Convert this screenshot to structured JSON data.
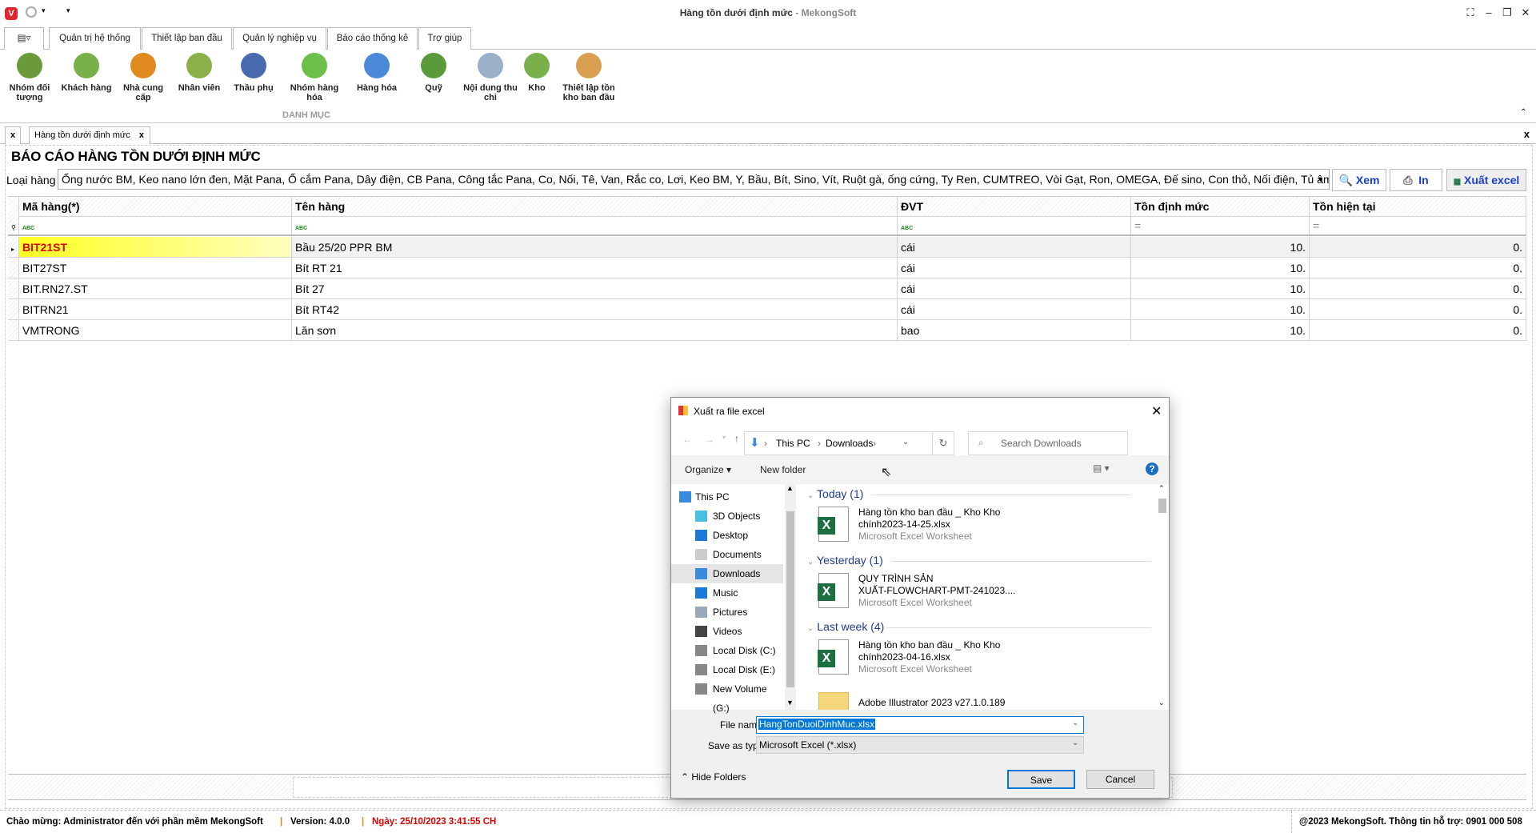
{
  "window": {
    "title": "Hàng tồn dưới định mức",
    "brand": " - MekongSoft",
    "logo": "V"
  },
  "menu_tabs": [
    "Quản trị hệ thống",
    "Thiết lập ban đầu",
    "Quản lý nghiệp vụ",
    "Báo cáo thống kê",
    "Trợ giúp"
  ],
  "ribbon": {
    "group": "DANH MỤC",
    "buttons": [
      {
        "label": "Nhóm đối tượng",
        "icon": "group-people-icon",
        "color": "#6a9a3a"
      },
      {
        "label": "Khách hàng",
        "icon": "customer-icon",
        "color": "#7ab04a"
      },
      {
        "label": "Nhà cung cấp",
        "icon": "supplier-icon",
        "color": "#e08a20"
      },
      {
        "label": "Nhân viên",
        "icon": "employee-icon",
        "color": "#8bb04a"
      },
      {
        "label": "Thầu phụ",
        "icon": "contractor-icon",
        "color": "#4a6ab0"
      },
      {
        "label": "Nhóm hàng hóa",
        "icon": "product-group-icon",
        "color": "#6cc04a"
      },
      {
        "label": "Hàng hóa",
        "icon": "star-icon",
        "color": "#4a8ad8"
      },
      {
        "label": "Quỹ",
        "icon": "money-icon",
        "color": "#5a9a3a"
      },
      {
        "label": "Nội dung thu chi",
        "icon": "document-add-icon",
        "color": "#9ab0c8"
      },
      {
        "label": "Kho",
        "icon": "warehouse-icon",
        "color": "#7ab04a"
      },
      {
        "label": "Thiết lập tồn kho ban đầu",
        "icon": "inventory-setup-icon",
        "color": "#d8a050"
      }
    ]
  },
  "doc_tab": {
    "label": "Hàng tồn dưới định mức",
    "close": "x"
  },
  "report": {
    "title": "BÁO CÁO HÀNG TỒN DƯỚI ĐỊNH MỨC",
    "filter_label": "Loại hàng",
    "filter_value": "Ống nước BM, Keo nano lớn đen, Mặt Pana, Ổ cắm Pana, Dây điện, CB Pana, Công tắc Pana, Co, Nối, Tê, Van, Rắc co, Lơi, Keo BM, Y, Bầu, Bít, Sino, Vít, Ruột gà, ống cứng, Ty Ren, CUMTREO, Vòi Gạt, Ron, OMEGA, Đế sino, Con thỏ, Nối điện, Tủ âm tườ...",
    "view_label": "Xem",
    "print_label": "In",
    "export_label": "Xuất excel"
  },
  "grid": {
    "columns": [
      "Mã hàng(*)",
      "Tên hàng",
      "ĐVT",
      "Tồn định mức",
      "Tồn hiện tại"
    ],
    "filter_ops": [
      "ABC",
      "ABC",
      "ABC",
      "=",
      "="
    ],
    "rows": [
      [
        "BIT21ST",
        "Bầu 25/20 PPR BM",
        "cái",
        "10.",
        "0."
      ],
      [
        "BIT27ST",
        "Bít RT 21",
        "cái",
        "10.",
        "0."
      ],
      [
        "BIT.RN27.ST",
        "Bít 27",
        "cái",
        "10.",
        "0."
      ],
      [
        "BITRN21",
        "Bít RT42",
        "cái",
        "10.",
        "0."
      ],
      [
        "VMTRONG",
        "Lăn sơn",
        "bao",
        "10.",
        "0."
      ]
    ]
  },
  "status": {
    "welcome": "Chào mừng: Administrator đến với phần mềm MekongSoft",
    "version": "Version: 4.0.0",
    "date": "Ngày: 25/10/2023 3:41:55 CH",
    "copyright": "@2023 MekongSoft. Thông tin hỗ trợ: 0901 000 508",
    "date_color": "#e00000"
  },
  "dialog": {
    "title": "Xuất ra file excel",
    "path": [
      "This PC",
      "Downloads"
    ],
    "search_placeholder": "Search Downloads",
    "organize": "Organize",
    "new_folder": "New folder",
    "nav": [
      "This PC",
      "3D Objects",
      "Desktop",
      "Documents",
      "Downloads",
      "Music",
      "Pictures",
      "Videos",
      "Local Disk (C:)",
      "Local Disk (E:)",
      "New Volume (G:)"
    ],
    "groups": [
      {
        "label": "Today (1)"
      },
      {
        "label": "Yesterday (1)"
      },
      {
        "label": "Last week (4)"
      }
    ],
    "files": [
      {
        "l1": "Hàng tồn kho ban đầu _ Kho Kho",
        "l2": "chính2023-14-25.xlsx",
        "type": "Microsoft Excel Worksheet"
      },
      {
        "l1": "QUY TRÌNH SẢN",
        "l2": "XUẤT-FLOWCHART-PMT-241023....",
        "type": "Microsoft Excel Worksheet"
      },
      {
        "l1": "Hàng tồn kho ban đầu _ Kho Kho",
        "l2": "chính2023-04-16.xlsx",
        "type": "Microsoft Excel Worksheet"
      },
      {
        "l1": "Adobe Illustrator 2023 v27.1.0.189"
      }
    ],
    "file_name_label": "File name:",
    "file_name": "HangTonDuoiDinhMuc.xlsx",
    "save_type_label": "Save as type:",
    "save_type": "Microsoft Excel  (*.xlsx)",
    "hide_folders": "Hide Folders",
    "save": "Save",
    "cancel": "Cancel"
  }
}
